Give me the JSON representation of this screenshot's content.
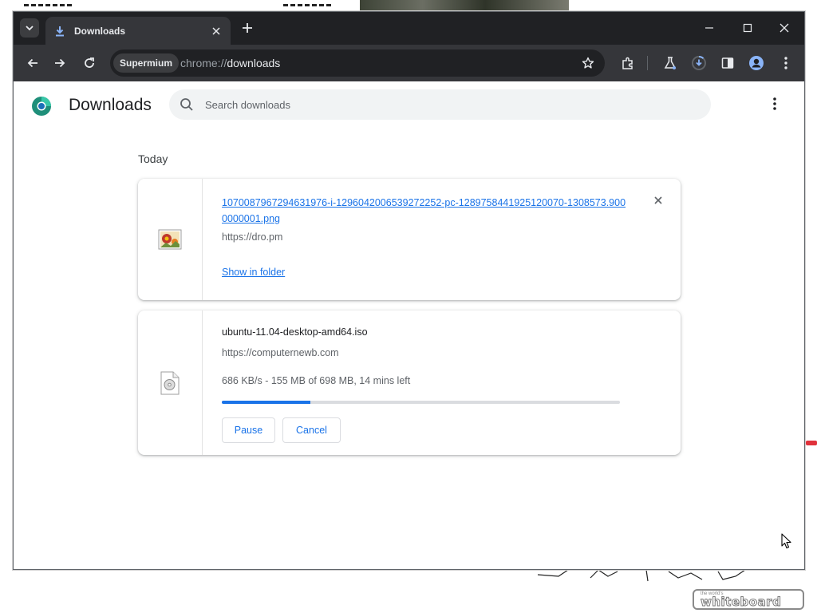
{
  "window": {
    "tab": {
      "title": "Downloads"
    },
    "omnibox": {
      "chip": "Supermium",
      "url_scheme": "chrome://",
      "url_path": "downloads"
    }
  },
  "page": {
    "title": "Downloads",
    "search": {
      "placeholder": "Search downloads",
      "value": ""
    },
    "date_header": "Today",
    "downloads": [
      {
        "filename": "1070087967294631976-i-1296042006539272252-pc-1289758441925120070-1308573.9000000001.png",
        "source": "https://dro.pm",
        "action_link": "Show in folder",
        "icon": "image-file-icon",
        "state": "complete"
      },
      {
        "filename": "ubuntu-11.04-desktop-amd64.iso",
        "source": "https://computernewb.com",
        "status": "686 KB/s - 155 MB of 698 MB, 14 mins left",
        "progress_fraction": 0.222,
        "pause_label": "Pause",
        "cancel_label": "Cancel",
        "icon": "disc-image-file-icon",
        "state": "in_progress"
      }
    ]
  },
  "desktop": {
    "logo_small": "the world's",
    "logo_big": "whiteboard"
  },
  "colors": {
    "accent": "#1a73e8",
    "titlebar": "#202124",
    "toolbar": "#35363a"
  }
}
